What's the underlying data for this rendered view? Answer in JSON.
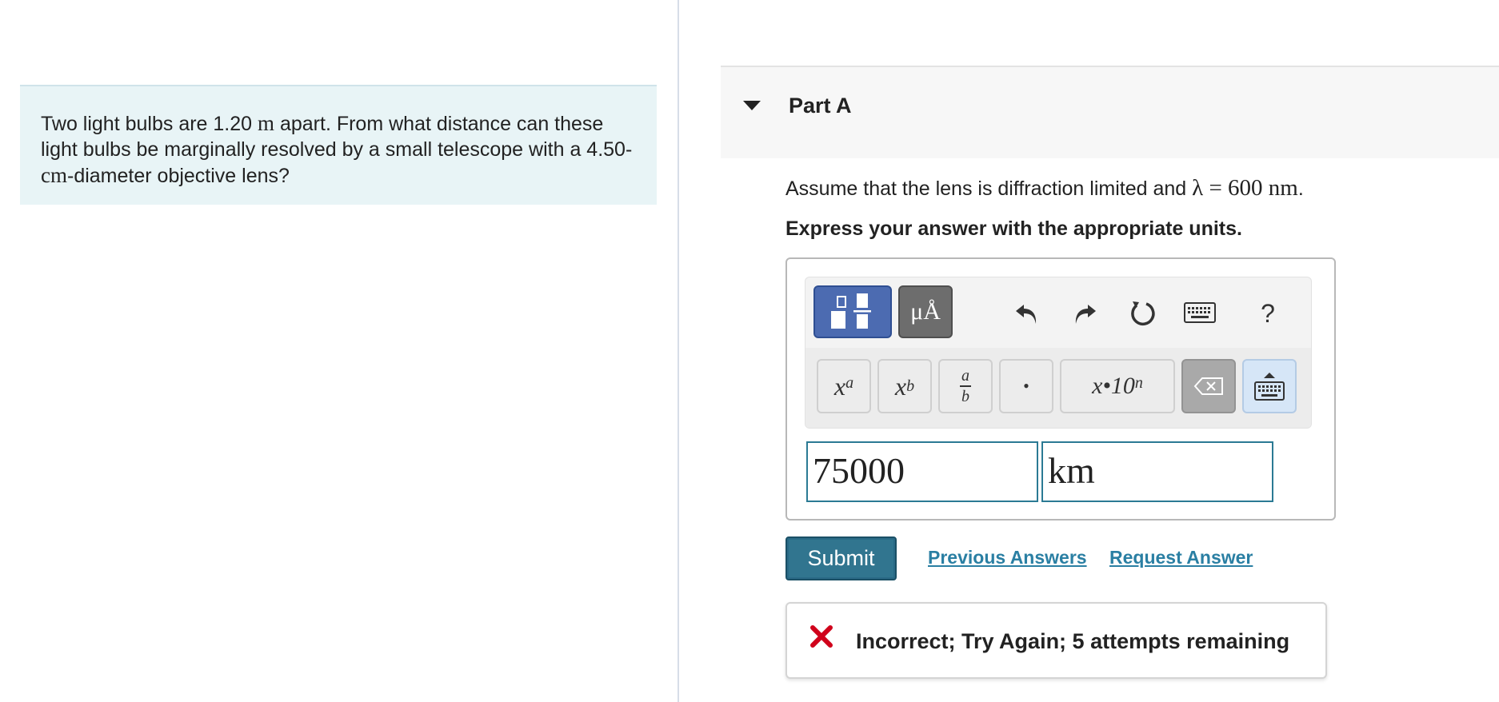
{
  "problem": {
    "text_before_m": "Two light bulbs are 1.20 ",
    "unit_m": "m",
    "text_after_m": " apart. From what distance can these light bulbs be marginally resolved by a small telescope with a 4.50-",
    "unit_cm": "cm",
    "text_after_cm": "-diameter objective lens?"
  },
  "part": {
    "title": "Part A",
    "assume_text": "Assume that the lens is diffraction limited and ",
    "assume_math": "λ = 600 nm",
    "assume_end": ".",
    "express": "Express your answer with the appropriate units."
  },
  "toolbar": {
    "templates_icon": "templates-icon",
    "units_label": "μÅ",
    "undo_icon": "undo-icon",
    "redo_icon": "redo-icon",
    "reset_icon": "reset-icon",
    "keyboard_icon": "keyboard-icon",
    "help_label": "?",
    "superscript_base": "x",
    "superscript_exp": "a",
    "subscript_base": "x",
    "subscript_sub": "b",
    "fraction_num": "a",
    "fraction_den": "b",
    "dot_label": "•",
    "sci_label": "x•10",
    "sci_exp": "n"
  },
  "answer": {
    "value": "75000",
    "unit": "km"
  },
  "actions": {
    "submit": "Submit",
    "previous_answers": "Previous Answers",
    "request_answer": "Request Answer"
  },
  "feedback": {
    "text": "Incorrect; Try Again; 5 attempts remaining",
    "color": "#d0021b"
  },
  "colors": {
    "accent": "#31758f",
    "link": "#2a7fa3",
    "problem_bg": "#e8f4f6"
  }
}
